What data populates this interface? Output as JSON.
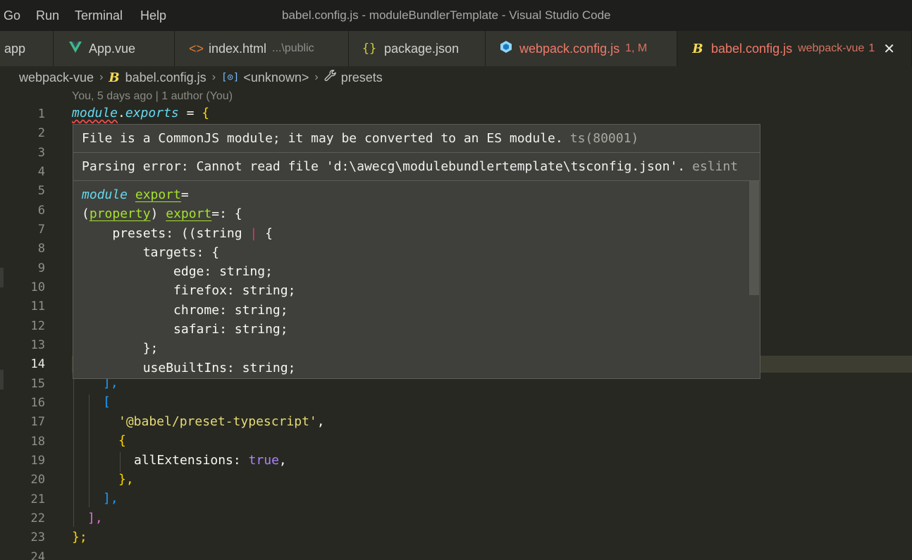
{
  "menu": {
    "go": "Go",
    "run": "Run",
    "terminal": "Terminal",
    "help": "Help"
  },
  "window_title": "babel.config.js - moduleBundlerTemplate - Visual Studio Code",
  "tabs": [
    {
      "label": "app",
      "icon": "folder-icon"
    },
    {
      "label": "App.vue",
      "icon": "vue-icon"
    },
    {
      "label": "index.html",
      "description": "...\\public",
      "icon": "html-icon"
    },
    {
      "label": "package.json",
      "icon": "json-icon"
    },
    {
      "label": "webpack.config.js",
      "status": "1, M",
      "icon": "webpack-icon"
    },
    {
      "label": "babel.config.js",
      "description": "webpack-vue",
      "status": "1",
      "icon": "babel-icon",
      "active": true
    }
  ],
  "breadcrumb": {
    "folder": "webpack-vue",
    "file": "babel.config.js",
    "symbol": "<unknown>",
    "property": "presets"
  },
  "blame": "You, 5 days ago | 1 author (You)",
  "line_numbers": [
    "1",
    "2",
    "3",
    "4",
    "5",
    "6",
    "7",
    "8",
    "9",
    "10",
    "11",
    "12",
    "13",
    "14",
    "15",
    "16",
    "17",
    "18",
    "19",
    "20",
    "21",
    "22",
    "23",
    "24"
  ],
  "current_line": 14,
  "code": {
    "l1_module": "module",
    "l1_dot": ".",
    "l1_exports": "exports",
    "l1_eq": " = ",
    "l1_brace": "{",
    "l15_bracket": "],",
    "l16_bracket": "[",
    "l17_str": "'@babel/preset-typescript'",
    "l17_comma": ",",
    "l18_brace": "{",
    "l19_prop": "allExtensions: ",
    "l19_bool": "true",
    "l19_comma": ",",
    "l20_brace": "},",
    "l21_bracket": "],",
    "l22_bracket": "],",
    "l23_end": "};"
  },
  "hover": {
    "problem1": "File is a CommonJS module; it may be converted to an ES module.",
    "problem1_source": "ts(80001)",
    "problem2": "Parsing error: Cannot read file 'd:\\awecg\\modulebundlertemplate\\tsconfig.json'.",
    "problem2_source": "eslint",
    "sig": {
      "module_kw": "module",
      "export_word": "export",
      "eq": "=",
      "paren_open": "(",
      "property_word": "property",
      "paren_close": ") ",
      "export_word2": "export",
      "eq_colon": "=: {",
      "presets_line": "    presets: ((string ",
      "pipe": "|",
      "presets_tail": " {",
      "targets": "        targets: {",
      "edge": "            edge: string;",
      "firefox": "            firefox: string;",
      "chrome": "            chrome: string;",
      "safari": "            safari: string;",
      "close": "        };",
      "usebuiltins": "        useBuiltIns: string;"
    }
  }
}
